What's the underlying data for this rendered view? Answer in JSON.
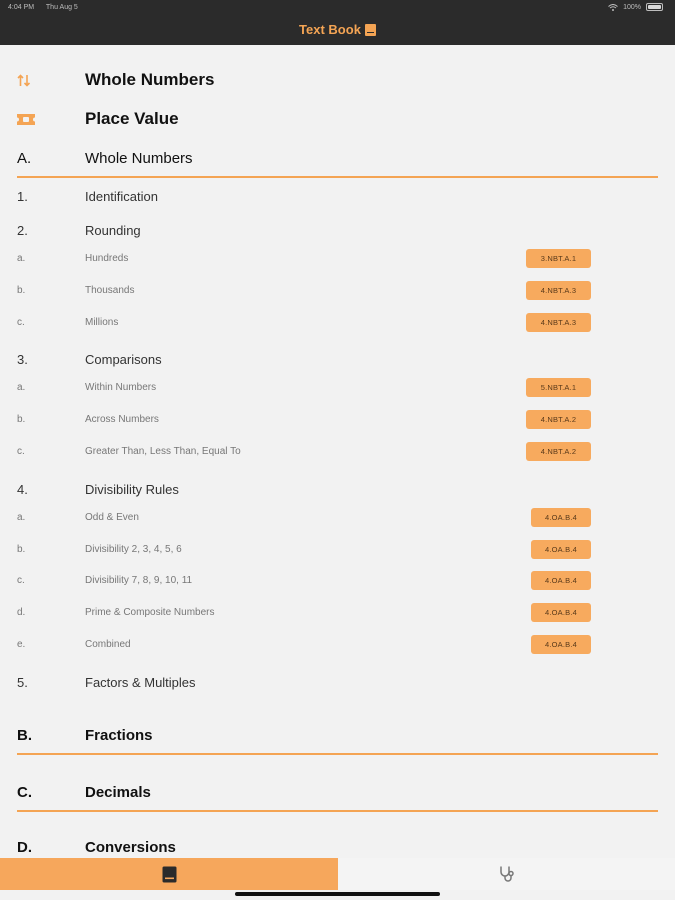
{
  "status_bar": {
    "time": "4:04 PM",
    "date": "Thu Aug 5",
    "battery": "100%"
  },
  "header": {
    "title": "Text Book"
  },
  "headings": [
    {
      "icon": "sort-icon",
      "label": "Whole Numbers"
    },
    {
      "icon": "ticket-icon",
      "label": "Place Value"
    }
  ],
  "section_a": {
    "letter": "A.",
    "title": "Whole Numbers"
  },
  "items": [
    {
      "num": "1.",
      "label": "Identification"
    },
    {
      "num": "2.",
      "label": "Rounding"
    },
    {
      "num": "3.",
      "label": "Comparisons"
    },
    {
      "num": "4.",
      "label": "Divisibility Rules"
    },
    {
      "num": "5.",
      "label": "Factors & Multiples"
    }
  ],
  "rounding_subs": [
    {
      "letter": "a.",
      "label": "Hundreds",
      "badge": "3.NBT.A.1"
    },
    {
      "letter": "b.",
      "label": "Thousands",
      "badge": "4.NBT.A.3"
    },
    {
      "letter": "c.",
      "label": "Millions",
      "badge": "4.NBT.A.3"
    }
  ],
  "comparison_subs": [
    {
      "letter": "a.",
      "label": "Within Numbers",
      "badge": "5.NBT.A.1"
    },
    {
      "letter": "b.",
      "label": "Across Numbers",
      "badge": "4.NBT.A.2"
    },
    {
      "letter": "c.",
      "label": "Greater Than, Less Than, Equal To",
      "badge": "4.NBT.A.2"
    }
  ],
  "divisibility_subs": [
    {
      "letter": "a.",
      "label": "Odd & Even",
      "badge": "4.OA.B.4"
    },
    {
      "letter": "b.",
      "label": "Divisibility 2, 3, 4, 5, 6",
      "badge": "4.OA.B.4"
    },
    {
      "letter": "c.",
      "label": "Divisibility 7, 8, 9, 10, 11",
      "badge": "4.OA.B.4"
    },
    {
      "letter": "d.",
      "label": "Prime & Composite Numbers",
      "badge": "4.OA.B.4"
    },
    {
      "letter": "e.",
      "label": "Combined",
      "badge": "4.OA.B.4"
    }
  ],
  "section_b": {
    "letter": "B.",
    "title": "Fractions"
  },
  "section_c": {
    "letter": "C.",
    "title": "Decimals"
  },
  "section_d": {
    "letter": "D.",
    "title": "Conversions"
  },
  "tabs": [
    {
      "icon": "book-icon",
      "active": true
    },
    {
      "icon": "stethoscope-icon",
      "active": false
    }
  ],
  "colors": {
    "accent": "#f4a454",
    "header_bg": "#2b2b2b",
    "badge_bg": "#f7aa5e",
    "background": "#f2f2f2"
  }
}
